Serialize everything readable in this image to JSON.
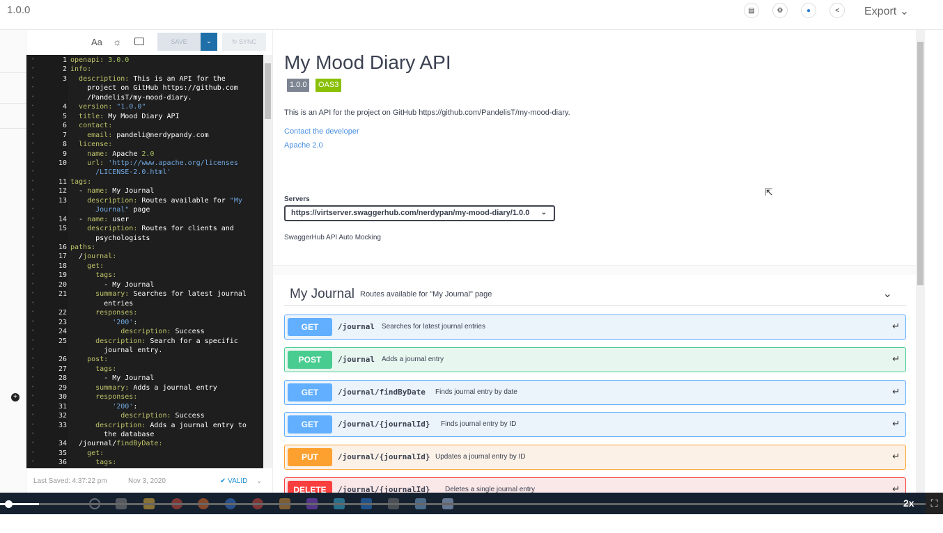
{
  "header": {
    "version": "1.0.0",
    "version_chevron": "⌄",
    "export_label": "Export ⌄",
    "icons": [
      "document-icon",
      "settings-icon",
      "bell-icon",
      "share-icon"
    ]
  },
  "toolbar": {
    "font_label": "Aa",
    "save_label": "SAVE",
    "sync_label": "SYNC"
  },
  "editor": {
    "lines": [
      {
        "n": "1",
        "fold": "",
        "html": "<span class='k'>openapi:</span> <span class='n'>3.0.0</span>"
      },
      {
        "n": "2",
        "fold": "▾",
        "html": "<span class='k'>info:</span>"
      },
      {
        "n": "3",
        "fold": "",
        "html": "  <span class='k'>description:</span> This is an API for the"
      },
      {
        "n": "",
        "fold": "",
        "html": "    project on GitHub https://github.com"
      },
      {
        "n": "",
        "fold": "",
        "html": "    /PandelisT/my-mood-diary."
      },
      {
        "n": "4",
        "fold": "",
        "html": "  <span class='k'>version:</span> <span class='s'>\"1.0.0\"</span>"
      },
      {
        "n": "5",
        "fold": "",
        "html": "  <span class='k'>title:</span> My Mood Diary API"
      },
      {
        "n": "6",
        "fold": "▾",
        "html": "  <span class='k'>contact:</span>"
      },
      {
        "n": "7",
        "fold": "",
        "html": "    <span class='k'>email:</span> pandeli@nerdypandy.com"
      },
      {
        "n": "8",
        "fold": "▾",
        "html": "  <span class='k'>license:</span>"
      },
      {
        "n": "9",
        "fold": "",
        "html": "    <span class='k'>name:</span> Apache <span class='n'>2.0</span>"
      },
      {
        "n": "10",
        "fold": "",
        "html": "    <span class='k'>url:</span> <span class='s'>'http://www.apache.org/licenses</span>"
      },
      {
        "n": "",
        "fold": "",
        "html": "      <span class='s'>/LICENSE-2.0.html'</span>"
      },
      {
        "n": "11",
        "fold": "▾",
        "html": "<span class='k'>tags:</span>"
      },
      {
        "n": "12",
        "fold": "▾",
        "html": "  - <span class='k'>name:</span> My Journal"
      },
      {
        "n": "13",
        "fold": "",
        "html": "    <span class='k'>description:</span> Routes available for <span class='s'>\"My</span>"
      },
      {
        "n": "",
        "fold": "",
        "html": "      <span class='s'>Journal\"</span> page"
      },
      {
        "n": "14",
        "fold": "▾",
        "html": "  - <span class='k'>name:</span> user"
      },
      {
        "n": "15",
        "fold": "",
        "html": "    <span class='k'>description:</span> Routes for clients and"
      },
      {
        "n": "",
        "fold": "",
        "html": "      psychologists"
      },
      {
        "n": "16",
        "fold": "▾",
        "html": "<span class='k'>paths:</span>"
      },
      {
        "n": "17",
        "fold": "▾",
        "html": "  /<span class='k'>journal:</span>"
      },
      {
        "n": "18",
        "fold": "▾",
        "html": "    <span class='k'>get:</span>"
      },
      {
        "n": "19",
        "fold": "▾",
        "html": "      <span class='k'>tags:</span>"
      },
      {
        "n": "20",
        "fold": "",
        "html": "        - My Journal"
      },
      {
        "n": "21",
        "fold": "",
        "html": "      <span class='k'>summary:</span> Searches for latest journal"
      },
      {
        "n": "",
        "fold": "",
        "html": "        entries"
      },
      {
        "n": "22",
        "fold": "▾",
        "html": "      <span class='k'>responses:</span>"
      },
      {
        "n": "23",
        "fold": "▾",
        "html": "          <span class='s'>'200'</span>:"
      },
      {
        "n": "24",
        "fold": "",
        "html": "            <span class='k'>description:</span> Success"
      },
      {
        "n": "25",
        "fold": "",
        "html": "      <span class='k'>description:</span> Search for a specific"
      },
      {
        "n": "",
        "fold": "",
        "html": "        journal entry."
      },
      {
        "n": "26",
        "fold": "▾",
        "html": "    <span class='k'>post:</span>"
      },
      {
        "n": "27",
        "fold": "▾",
        "html": "      <span class='k'>tags:</span>"
      },
      {
        "n": "28",
        "fold": "",
        "html": "        - My Journal"
      },
      {
        "n": "29",
        "fold": "",
        "html": "      <span class='k'>summary:</span> Adds a journal entry"
      },
      {
        "n": "30",
        "fold": "▾",
        "html": "      <span class='k'>responses:</span>"
      },
      {
        "n": "31",
        "fold": "▾",
        "html": "          <span class='s'>'200'</span>:"
      },
      {
        "n": "32",
        "fold": "",
        "html": "            <span class='k'>description:</span> Success"
      },
      {
        "n": "33",
        "fold": "",
        "html": "      <span class='k'>description:</span> Adds a journal entry to"
      },
      {
        "n": "",
        "fold": "",
        "html": "        the database"
      },
      {
        "n": "34",
        "fold": "▾",
        "html": "  /journal/<span class='k'>findByDate:</span>"
      },
      {
        "n": "35",
        "fold": "▾",
        "html": "    <span class='k'>get:</span>"
      },
      {
        "n": "36",
        "fold": "▾",
        "html": "      <span class='k'>tags:</span>"
      }
    ]
  },
  "status": {
    "saved": "Last Saved: 4:37:22 pm",
    "date": "Nov 3, 2020",
    "valid": "✔ VALID",
    "valid_chevron": "⌄"
  },
  "docs": {
    "title": "My Mood Diary API",
    "version_badge": "1.0.0",
    "oas_badge": "OAS3",
    "description": "This is an API for the project on GitHub https://github.com/PandelisT/my-mood-diary.",
    "contact_link": "Contact the developer",
    "license_link": "Apache 2.0",
    "servers_label": "Servers",
    "server_value": "https://virtserver.swaggerhub.com/nerdypan/my-mood-diary/1.0.0",
    "mocking_label": "SwaggerHub API Auto Mocking"
  },
  "tag": {
    "name": "My Journal",
    "description": "Routes available for \"My Journal\" page"
  },
  "operations": [
    {
      "method": "GET",
      "path": "/journal",
      "summary": "Searches for latest journal entries"
    },
    {
      "method": "POST",
      "path": "/journal",
      "summary": "Adds a journal entry"
    },
    {
      "method": "GET",
      "path": "/journal/findByDate",
      "summary": "Finds journal entry by date"
    },
    {
      "method": "GET",
      "path": "/journal/{journalId}",
      "summary": "Finds journal entry by ID"
    },
    {
      "method": "PUT",
      "path": "/journal/{journalId}",
      "summary": "Updates a journal entry by ID"
    },
    {
      "method": "DELETE",
      "path": "/journal/{journalId}",
      "summary": "Deletes a single journal entry"
    }
  ],
  "player": {
    "speed": "2x"
  },
  "colors": {
    "get": "#61affe",
    "post": "#49cc90",
    "put": "#fca130",
    "delete": "#f93e3e"
  }
}
